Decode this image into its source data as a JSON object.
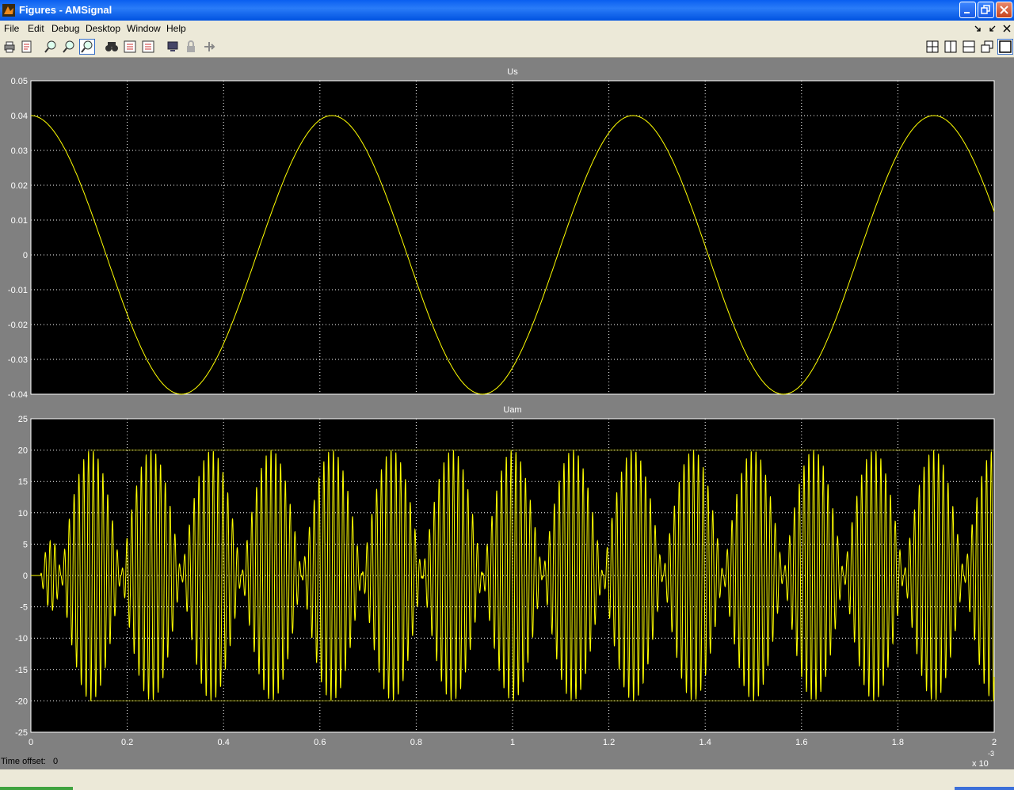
{
  "window": {
    "title": "Figures - AMSignal"
  },
  "menubar": {
    "items": [
      "File",
      "Edit",
      "Debug",
      "Desktop",
      "Window",
      "Help"
    ]
  },
  "toolbar": {
    "icons": [
      "print-icon",
      "print-preview-icon",
      "zoom-in-icon",
      "zoom-out-icon",
      "zoom-icon",
      "find-icon",
      "grid-icon-a",
      "grid-icon-b",
      "monitor-icon",
      "lock-icon",
      "pin-icon"
    ],
    "layout_icons": [
      "tile-layout-icon",
      "left-right-layout-icon",
      "top-bottom-layout-icon",
      "float-layout-icon",
      "maximize-layout-icon"
    ]
  },
  "statusbar": {
    "label": "Time offset:",
    "value": "0"
  },
  "colors": {
    "plot_bg": "#000000",
    "trace": "#ffff00",
    "figure_bg": "#808080"
  },
  "chart_data": [
    {
      "type": "line",
      "title": "Us",
      "series": [
        {
          "function": "0.04*cos(2*pi*1600*t)",
          "amplitude": 0.04,
          "frequency_hz": 1600
        }
      ],
      "xlim": [
        0,
        0.002
      ],
      "ylim": [
        -0.04,
        0.05
      ],
      "yticks": [
        0.05,
        0.04,
        0.03,
        0.02,
        0.01,
        0,
        -0.01,
        -0.02,
        -0.03,
        -0.04
      ],
      "ytick_labels": [
        "0.05",
        "0.04",
        "0.03",
        "0.02",
        "0.01",
        "0",
        "-0.01",
        "-0.02",
        "-0.03",
        "-0.04"
      ],
      "grid": true
    },
    {
      "type": "line",
      "title": "Uam",
      "series": [
        {
          "carrier_hz": 100000,
          "envelope_peak": 20,
          "startup_overshoot_peak": 22.7,
          "envelope_cycles": 16
        }
      ],
      "xlim": [
        0,
        0.002
      ],
      "ylim": [
        -25,
        25
      ],
      "yticks": [
        25,
        20,
        15,
        10,
        5,
        0,
        -5,
        -10,
        -15,
        -20,
        -25
      ],
      "ytick_labels": [
        "25",
        "20",
        "15",
        "10",
        "5",
        "0",
        "-5",
        "-10",
        "-15",
        "-20",
        "-25"
      ],
      "xticks": [
        0,
        0.2,
        0.4,
        0.6,
        0.8,
        1,
        1.2,
        1.4,
        1.6,
        1.8,
        2
      ],
      "xtick_labels": [
        "0",
        "0.2",
        "0.4",
        "0.6",
        "0.8",
        "1",
        "1.2",
        "1.4",
        "1.6",
        "1.8",
        "2"
      ],
      "x_multiplier": "x 10",
      "x_multiplier_exp": "-3",
      "grid": true
    }
  ]
}
